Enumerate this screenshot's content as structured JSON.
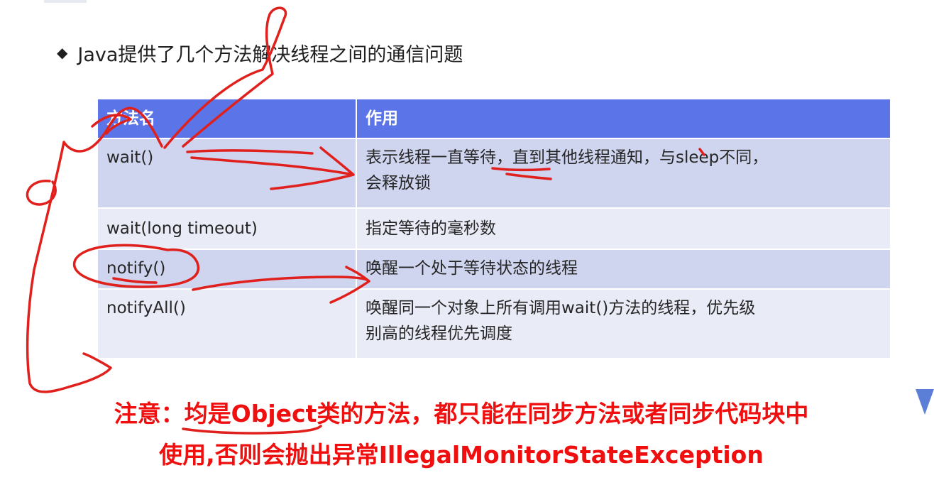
{
  "heading": {
    "bullet": "◆",
    "text": "Java提供了几个方法解决线程之间的通信问题"
  },
  "table": {
    "headers": [
      "方法名",
      "作用"
    ],
    "rows": [
      {
        "name": "wait()",
        "desc_lines": [
          "表示线程一直等待，直到其他线程通知，与sleep不同，",
          "会释放锁"
        ]
      },
      {
        "name": "wait(long timeout)",
        "desc_lines": [
          "指定等待的毫秒数"
        ]
      },
      {
        "name": "notify()",
        "desc_lines": [
          "唤醒一个处于等待状态的线程"
        ]
      },
      {
        "name": "notifyAll()",
        "desc_lines": [
          "唤醒同一个对象上所有调用wait()方法的线程，优先级",
          "别高的线程优先调度"
        ]
      }
    ]
  },
  "note": {
    "line1": "注意：均是Object类的方法，都只能在同步方法或者同步代码块中",
    "line2": "使用,否则会抛出异常IllegalMonitorStateException"
  },
  "colors": {
    "header_bg": "#5b74e8",
    "row_dark": "#cfd4ef",
    "row_light": "#e9ebf7",
    "note_red": "#f00f0f",
    "ink_red": "#e0201c"
  }
}
